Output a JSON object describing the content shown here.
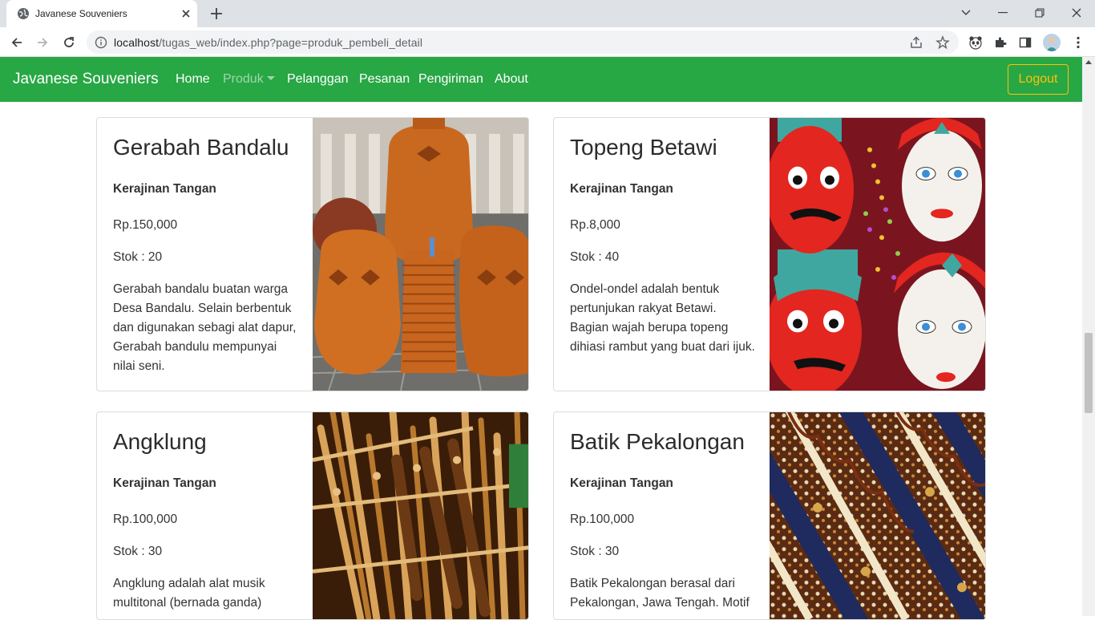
{
  "browser": {
    "tab_title": "Javanese Souveniers",
    "url_host": "localhost",
    "url_path": "/tugas_web/index.php?page=produk_pembeli_detail"
  },
  "navbar": {
    "brand": "Javanese Souveniers",
    "links": [
      "Home",
      "Produk",
      "Pelanggan",
      "Pesanan",
      "Pengiriman",
      "About"
    ],
    "logout": "Logout",
    "colors": {
      "bg": "#28a745",
      "logout": "#ffc107"
    }
  },
  "products": [
    {
      "name": "Gerabah Bandalu",
      "category": "Kerajinan Tangan",
      "price": "Rp.150,000",
      "stock": "Stok : 20",
      "description": "Gerabah bandalu buatan warga Desa Bandalu. Selain berbentuk dan digunakan sebagi alat dapur, Gerabah bandulu mempunyai nilai seni."
    },
    {
      "name": "Topeng Betawi",
      "category": "Kerajinan Tangan",
      "price": "Rp.8,000",
      "stock": "Stok : 40",
      "description": "Ondel-ondel adalah bentuk pertunjukan rakyat Betawi. Bagian wajah berupa topeng dihiasi rambut yang buat dari ijuk."
    },
    {
      "name": "Angklung",
      "category": "Kerajinan Tangan",
      "price": "Rp.100,000",
      "stock": "Stok : 30",
      "description": "Angklung adalah alat musik multitonal (bernada ganda)"
    },
    {
      "name": "Batik Pekalongan",
      "category": "Kerajinan Tangan",
      "price": "Rp.100,000",
      "stock": "Stok : 30",
      "description": "Batik Pekalongan berasal dari Pekalongan, Jawa Tengah. Motif"
    }
  ]
}
